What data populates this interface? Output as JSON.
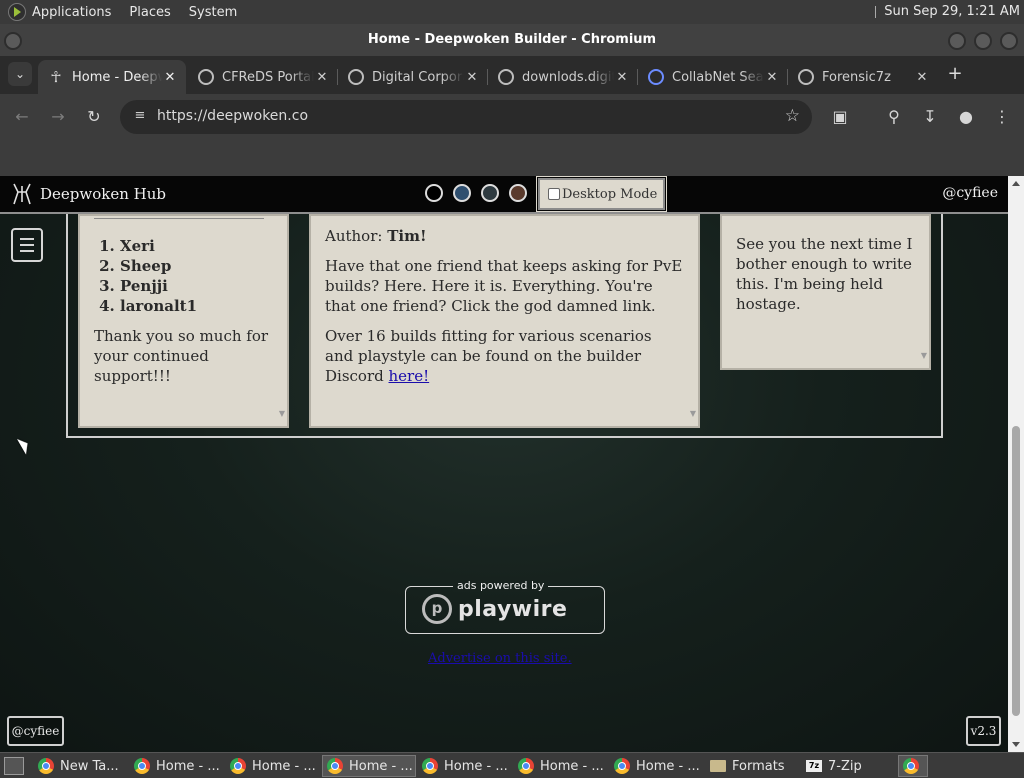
{
  "desktop_panel": {
    "menus": [
      "Applications",
      "Places",
      "System"
    ],
    "clock": "Sun Sep 29,  1:21 AM"
  },
  "window": {
    "title": "Home - Deepwoken Builder - Chromium"
  },
  "browser": {
    "tabs": [
      {
        "label": "Home - Deepwoken Builder",
        "icon": "deepwoken-icon",
        "active": true
      },
      {
        "label": "CFReDS Portal",
        "icon": "globe-icon",
        "active": false
      },
      {
        "label": "Digital Corpora",
        "icon": "globe-icon",
        "active": false
      },
      {
        "label": "downlods.digitalcorpora",
        "icon": "globe-icon",
        "active": false
      },
      {
        "label": "CollabNet Search",
        "icon": "search-icon",
        "active": false
      },
      {
        "label": "Forensic7z",
        "icon": "globe-icon",
        "active": false
      }
    ],
    "new_tab": "+",
    "url": "https://deepwoken.co"
  },
  "site": {
    "brand": "Deepwoken Hub",
    "desktop_mode_label": "Desktop Mode",
    "user_handle": "@cyfiee",
    "theme_colors": [
      "#000000",
      "#2f4f6f",
      "#2e3a40",
      "#5a3a2c"
    ],
    "supporters": {
      "names": [
        "Xeri",
        "Sheep",
        "Penjji",
        "laronalt1"
      ],
      "thanks": "Thank you so much for your continued support!!!"
    },
    "post": {
      "author_label": "Author:",
      "author": "Tim!",
      "p1": "Have that one friend that keeps asking for PvE builds? Here. Here it is. Everything. You're that one friend? Click the god damned link.",
      "p2": "Over 16 builds fitting for various scenarios and playstyle can be found on the builder Discord",
      "link": "here!"
    },
    "note": "See you the next time I bother enough to write this. I'm being held hostage.",
    "ad": {
      "label": "ads powered by",
      "brand": "playwire",
      "link": "Advertise on this site."
    },
    "footer_handle": "@cyfiee",
    "version": "v2.3"
  },
  "taskbar": {
    "items": [
      {
        "label": "New Ta...",
        "icon": "chromium-icon"
      },
      {
        "label": "Home - ...",
        "icon": "chromium-icon"
      },
      {
        "label": "Home - ...",
        "icon": "chromium-icon"
      },
      {
        "label": "Home - ...",
        "icon": "chromium-icon",
        "active": true
      },
      {
        "label": "Home - ...",
        "icon": "chromium-icon"
      },
      {
        "label": "Home - ...",
        "icon": "chromium-icon"
      },
      {
        "label": "Home - ...",
        "icon": "chromium-icon"
      },
      {
        "label": "Formats",
        "icon": "folder-icon"
      },
      {
        "label": "7-Zip",
        "icon": "7zip-icon"
      },
      {
        "label": "",
        "icon": "chromium-icon"
      }
    ]
  }
}
